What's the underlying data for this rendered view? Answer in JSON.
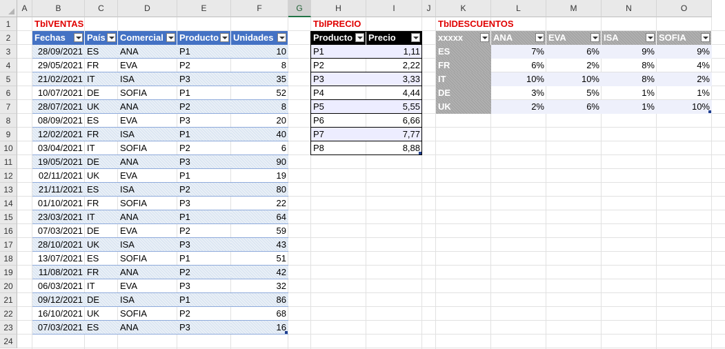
{
  "columns": [
    "A",
    "B",
    "C",
    "D",
    "E",
    "F",
    "G",
    "H",
    "I",
    "J",
    "K",
    "L",
    "M",
    "N",
    "O"
  ],
  "rows": [
    "1",
    "2",
    "3",
    "4",
    "5",
    "6",
    "7",
    "8",
    "9",
    "10",
    "11",
    "12",
    "13",
    "14",
    "15",
    "16",
    "17",
    "18",
    "19",
    "20",
    "21",
    "22",
    "23",
    "24"
  ],
  "selected_column": "G",
  "ventas": {
    "title": "TblVENTAS",
    "headers": [
      "Fechas",
      "País",
      "Comercial",
      "Producto",
      "Unidades"
    ],
    "rows": [
      [
        "28/09/2021",
        "ES",
        "ANA",
        "P1",
        "10"
      ],
      [
        "29/05/2021",
        "FR",
        "EVA",
        "P2",
        "8"
      ],
      [
        "21/02/2021",
        "IT",
        "ISA",
        "P3",
        "35"
      ],
      [
        "10/07/2021",
        "DE",
        "SOFIA",
        "P1",
        "52"
      ],
      [
        "28/07/2021",
        "UK",
        "ANA",
        "P2",
        "8"
      ],
      [
        "08/09/2021",
        "ES",
        "EVA",
        "P3",
        "20"
      ],
      [
        "12/02/2021",
        "FR",
        "ISA",
        "P1",
        "40"
      ],
      [
        "03/04/2021",
        "IT",
        "SOFIA",
        "P2",
        "6"
      ],
      [
        "19/05/2021",
        "DE",
        "ANA",
        "P3",
        "90"
      ],
      [
        "02/11/2021",
        "UK",
        "EVA",
        "P1",
        "19"
      ],
      [
        "21/11/2021",
        "ES",
        "ISA",
        "P2",
        "80"
      ],
      [
        "01/10/2021",
        "FR",
        "SOFIA",
        "P3",
        "22"
      ],
      [
        "23/03/2021",
        "IT",
        "ANA",
        "P1",
        "64"
      ],
      [
        "07/03/2021",
        "DE",
        "EVA",
        "P2",
        "59"
      ],
      [
        "28/10/2021",
        "UK",
        "ISA",
        "P3",
        "43"
      ],
      [
        "13/07/2021",
        "ES",
        "SOFIA",
        "P1",
        "51"
      ],
      [
        "11/08/2021",
        "FR",
        "ANA",
        "P2",
        "42"
      ],
      [
        "06/03/2021",
        "IT",
        "EVA",
        "P3",
        "32"
      ],
      [
        "09/12/2021",
        "DE",
        "ISA",
        "P1",
        "86"
      ],
      [
        "16/10/2021",
        "UK",
        "SOFIA",
        "P2",
        "68"
      ],
      [
        "07/03/2021",
        "ES",
        "ANA",
        "P3",
        "16"
      ]
    ]
  },
  "precio": {
    "title": "TblPRECIO",
    "headers": [
      "Producto",
      "Precio"
    ],
    "rows": [
      [
        "P1",
        "1,11"
      ],
      [
        "P2",
        "2,22"
      ],
      [
        "P3",
        "3,33"
      ],
      [
        "P4",
        "4,44"
      ],
      [
        "P5",
        "5,55"
      ],
      [
        "P6",
        "6,66"
      ],
      [
        "P7",
        "7,77"
      ],
      [
        "P8",
        "8,88"
      ]
    ]
  },
  "descuentos": {
    "title": "TblDESCUENTOS",
    "headers": [
      "xxxxx",
      "ANA",
      "EVA",
      "ISA",
      "SOFIA"
    ],
    "rows": [
      [
        "ES",
        "7%",
        "6%",
        "9%",
        "9%"
      ],
      [
        "FR",
        "6%",
        "2%",
        "8%",
        "4%"
      ],
      [
        "IT",
        "10%",
        "10%",
        "8%",
        "2%"
      ],
      [
        "DE",
        "3%",
        "5%",
        "1%",
        "1%"
      ],
      [
        "UK",
        "2%",
        "6%",
        "1%",
        "10%"
      ]
    ]
  },
  "colors": {
    "title_red": "#e00000",
    "ventas_header": "#4472c4",
    "precio_header": "#000000",
    "descuentos_header": "#a5a5a5"
  }
}
